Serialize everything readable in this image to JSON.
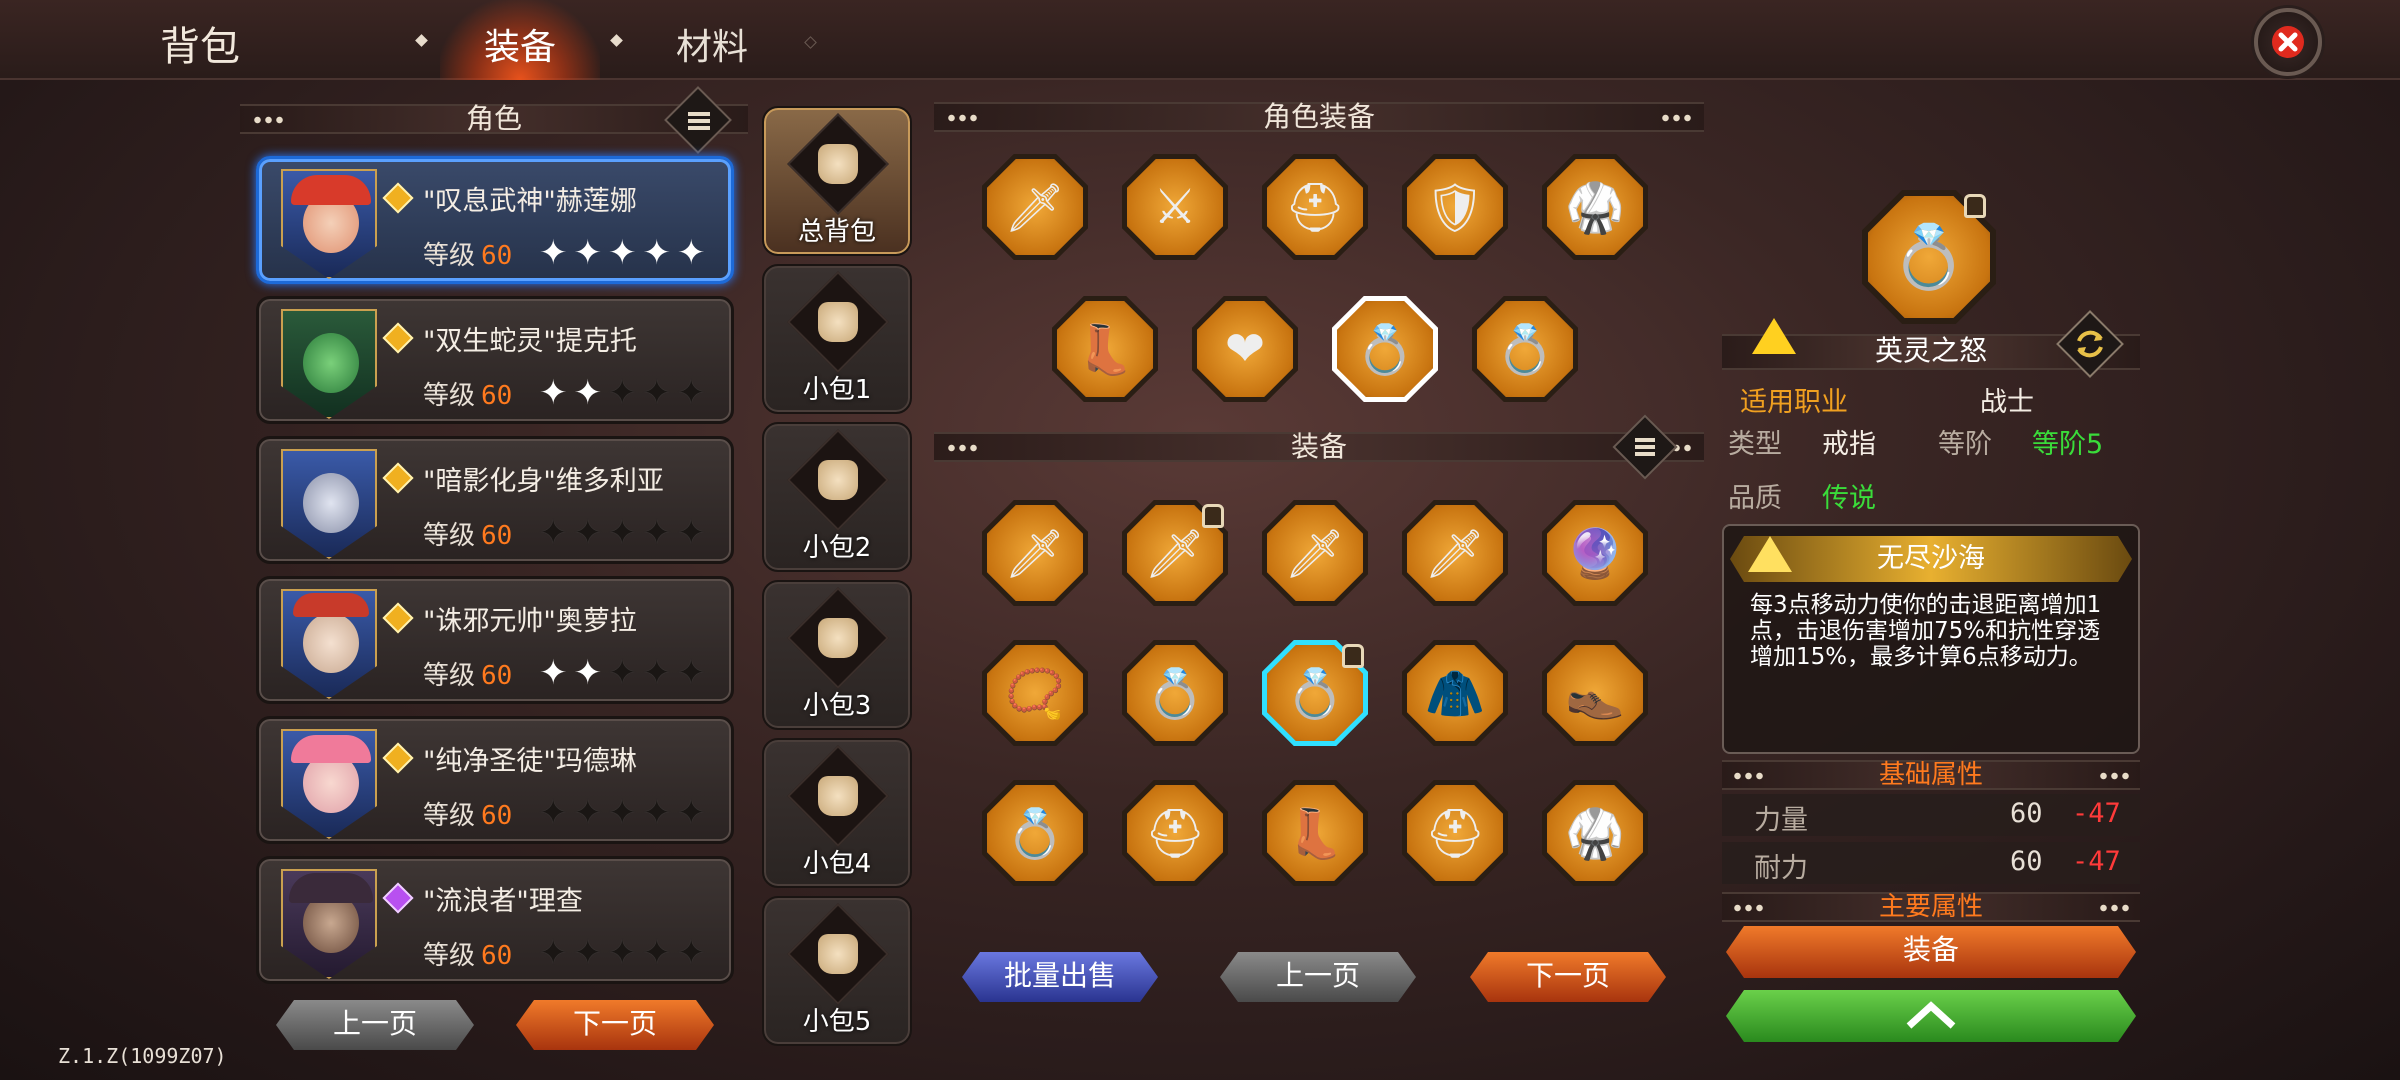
{
  "header": {
    "title": "背包",
    "tabs": [
      "装备",
      "材料"
    ]
  },
  "characters": {
    "section_title": "角色",
    "list": [
      {
        "name": "\"叹息武神\"赫莲娜",
        "level_label": "等级",
        "level": "60",
        "stars": 5,
        "rarity": "gold"
      },
      {
        "name": "\"双生蛇灵\"提克托",
        "level_label": "等级",
        "level": "60",
        "stars": 2,
        "rarity": "gold"
      },
      {
        "name": "\"暗影化身\"维多利亚",
        "level_label": "等级",
        "level": "60",
        "stars": 0,
        "rarity": "gold"
      },
      {
        "name": "\"诛邪元帅\"奥萝拉",
        "level_label": "等级",
        "level": "60",
        "stars": 2,
        "rarity": "gold"
      },
      {
        "name": "\"纯净圣徒\"玛德琳",
        "level_label": "等级",
        "level": "60",
        "stars": 0,
        "rarity": "gold"
      },
      {
        "name": "\"流浪者\"理查",
        "level_label": "等级",
        "level": "60",
        "stars": 0,
        "rarity": "purple"
      }
    ],
    "prev_label": "上一页",
    "next_label": "下一页"
  },
  "bags": [
    "总背包",
    "小包1",
    "小包2",
    "小包3",
    "小包4",
    "小包5"
  ],
  "character_equipment": {
    "section_title": "角色装备",
    "row1": [
      "red-sword-icon",
      "red-greatsword-icon",
      "blue-helmet-icon",
      "blue-armor-icon",
      "blue-greaves-icon"
    ],
    "row2": [
      "blue-boots-icon",
      "heart-amulet-icon",
      "teal-ring-icon",
      "blue-ring-icon"
    ]
  },
  "equipment": {
    "section_title": "装备",
    "grid": [
      [
        "steel-sword-icon",
        "red-sword-icon",
        "red-sword-icon",
        "red-sword-icon",
        "purple-amulet-icon"
      ],
      [
        "bronze-amulet-icon",
        "purple-ring-icon",
        "orange-ring-icon",
        "red-cape-icon",
        "dark-boots-icon"
      ],
      [
        "dark-ring-icon",
        "spiked-helmet-icon",
        "black-boots-icon",
        "gold-helmet-icon",
        "dark-greaves-icon"
      ]
    ],
    "batch_sell_label": "批量出售",
    "prev_label": "上一页",
    "next_label": "下一页"
  },
  "item_detail": {
    "name": "英灵之怒",
    "job_label": "适用职业",
    "job_value": "战士",
    "type_label": "类型",
    "type_value": "戒指",
    "tier_label": "等阶",
    "tier_value": "等阶5",
    "quality_label": "品质",
    "quality_value": "传说",
    "set_name": "无尽沙海",
    "description": "每3点移动力使你的击退距离增加1点，击退伤害增加75%和抗性穿透增加15%，最多计算6点移动力。",
    "base_attr_title": "基础属性",
    "stats": [
      {
        "name": "力量",
        "value": "60",
        "diff": "-47"
      },
      {
        "name": "耐力",
        "value": "60",
        "diff": "-47"
      }
    ],
    "main_attr_title": "主要属性",
    "equip_label": "装备"
  },
  "version": "Z.1.Z(1099Z07)",
  "colors": {
    "accent_orange": "#ff7a1e",
    "quality_green": "#3adc3a",
    "job_orange": "#f0a020",
    "diff_red": "#ff3a3a",
    "select_blue": "#2a7aff"
  }
}
